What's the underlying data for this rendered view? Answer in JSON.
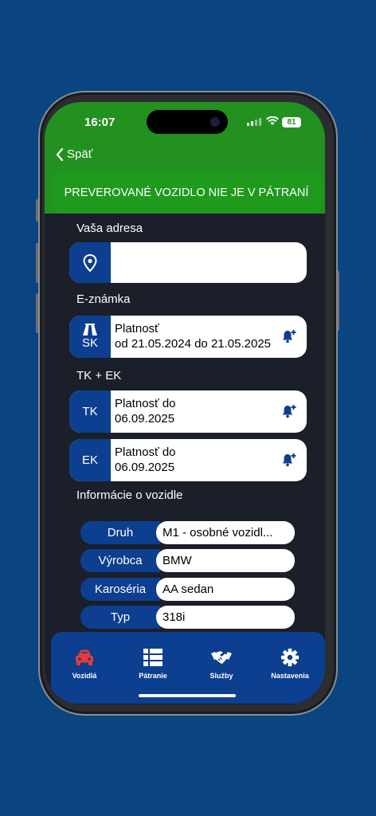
{
  "status_bar": {
    "time": "16:07",
    "battery": "81"
  },
  "nav": {
    "back_label": "Späť"
  },
  "banner": {
    "text": "PREVEROVANÉ VOZIDLO NIE JE V PÁTRANÍ"
  },
  "address": {
    "label": "Vaša adresa",
    "value": ""
  },
  "eznamka": {
    "label": "E-známka",
    "tag": "SK",
    "line1": "Platnosť",
    "line2": "od 21.05.2024 do 21.05.2025"
  },
  "tkek": {
    "label": "TK + EK",
    "tk": {
      "tag": "TK",
      "line1": "Platnosť do",
      "line2": "06.09.2025"
    },
    "ek": {
      "tag": "EK",
      "line1": "Platnosť do",
      "line2": "06.09.2025"
    }
  },
  "info": {
    "label": "Informácie o vozidle",
    "rows": [
      {
        "key": "Druh",
        "value": "M1 - osobné vozidl..."
      },
      {
        "key": "Výrobca",
        "value": "BMW"
      },
      {
        "key": "Karoséria",
        "value": "AA sedan"
      },
      {
        "key": "Typ",
        "value": "318i"
      }
    ]
  },
  "tabs": [
    {
      "label": "Vozidlá",
      "icon": "car-icon",
      "active": true
    },
    {
      "label": "Pátranie",
      "icon": "list-icon",
      "active": false
    },
    {
      "label": "Služby",
      "icon": "handshake-icon",
      "active": false
    },
    {
      "label": "Nastavenia",
      "icon": "gear-icon",
      "active": false
    }
  ],
  "colors": {
    "background": "#0a4582",
    "header_green": "#22911f",
    "accent_blue": "#0c3f8f",
    "active_tab": "#e63b3b"
  }
}
